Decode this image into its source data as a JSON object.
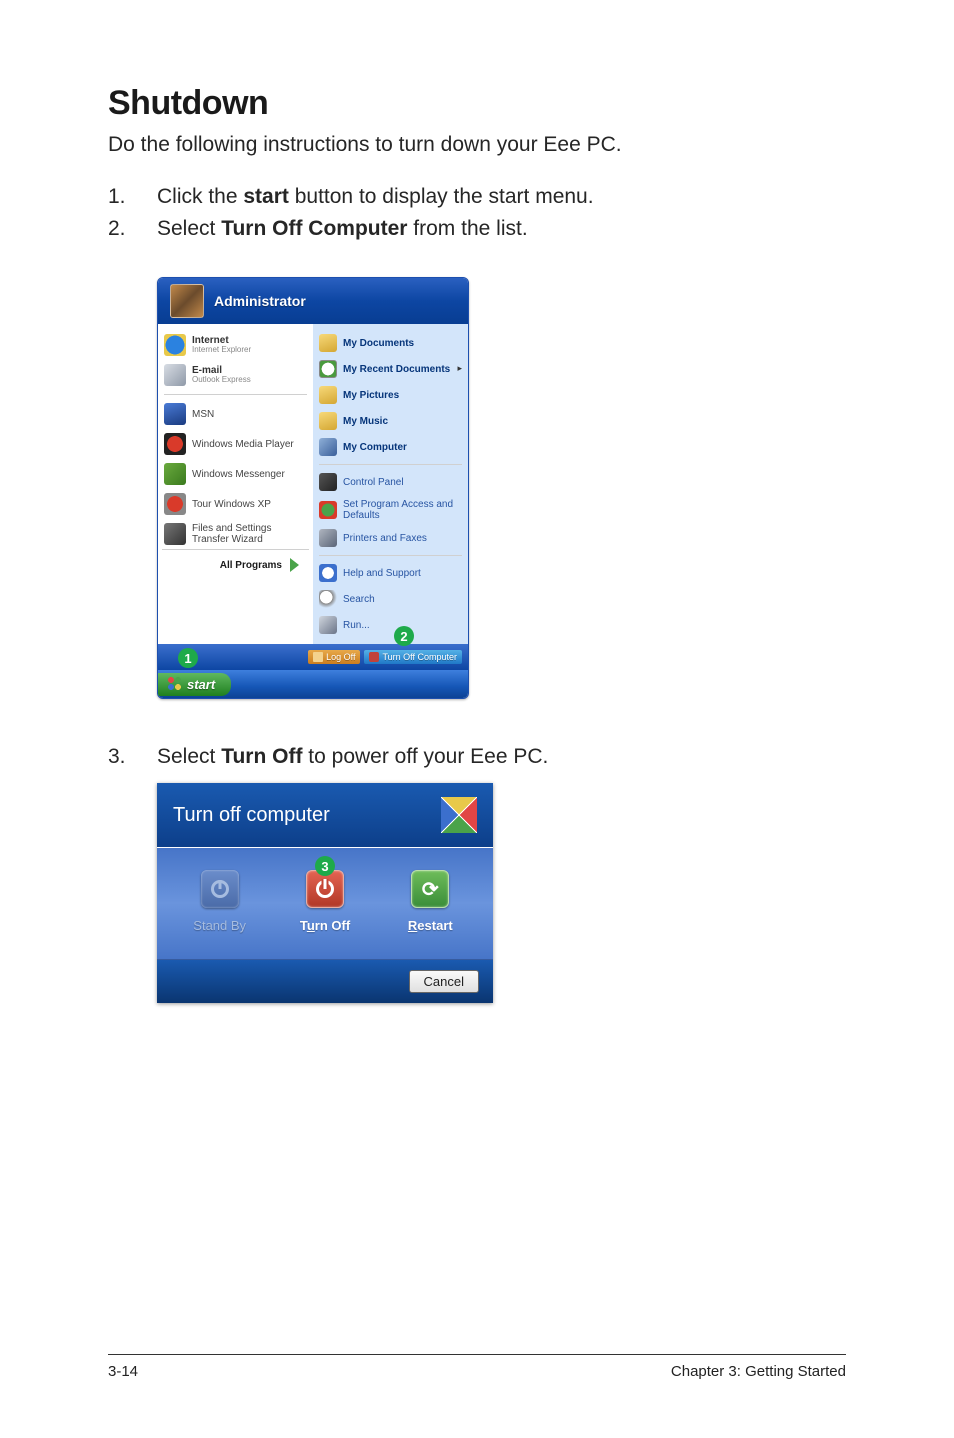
{
  "heading": "Shutdown",
  "intro": "Do the following instructions to turn down your Eee PC.",
  "steps": [
    {
      "num": "1.",
      "pre": "Click the ",
      "bold": "start",
      "post": " button to display the start menu."
    },
    {
      "num": "2.",
      "pre": "Select ",
      "bold": "Turn Off Computer",
      "post": " from the list."
    },
    {
      "num": "3.",
      "pre": "Select ",
      "bold": "Turn Off",
      "post": " to power off your Eee PC."
    }
  ],
  "startmenu": {
    "user": "Administrator",
    "left_pinned": [
      {
        "title": "Internet",
        "sub": "Internet Explorer"
      },
      {
        "title": "E-mail",
        "sub": "Outlook Express"
      }
    ],
    "left_recent": [
      {
        "title": "MSN"
      },
      {
        "title": "Windows Media Player"
      },
      {
        "title": "Windows Messenger"
      },
      {
        "title": "Tour Windows XP"
      },
      {
        "title": "Files and Settings Transfer Wizard"
      }
    ],
    "all_programs": "All Programs",
    "right_top": [
      {
        "title": "My Documents"
      },
      {
        "title": "My Recent Documents",
        "chevron": true
      },
      {
        "title": "My Pictures"
      },
      {
        "title": "My Music"
      },
      {
        "title": "My Computer"
      }
    ],
    "right_mid": [
      {
        "title": "Control Panel"
      },
      {
        "title": "Set Program Access and Defaults"
      },
      {
        "title": "Printers and Faxes"
      }
    ],
    "right_bottom": [
      {
        "title": "Help and Support"
      },
      {
        "title": "Search"
      },
      {
        "title": "Run..."
      }
    ],
    "logoff_label": "Log Off",
    "turnoff_label": "Turn Off Computer",
    "start_label": "start"
  },
  "badges": {
    "one": "1",
    "two": "2",
    "three": "3"
  },
  "turnoff_dialog": {
    "title": "Turn off computer",
    "standby": "Stand By",
    "turnoff_pre": "T",
    "turnoff_u": "u",
    "turnoff_post": "rn Off",
    "restart_u": "R",
    "restart_post": "estart",
    "cancel": "Cancel"
  },
  "footer": {
    "left": "3-14",
    "right": "Chapter 3: Getting Started"
  }
}
